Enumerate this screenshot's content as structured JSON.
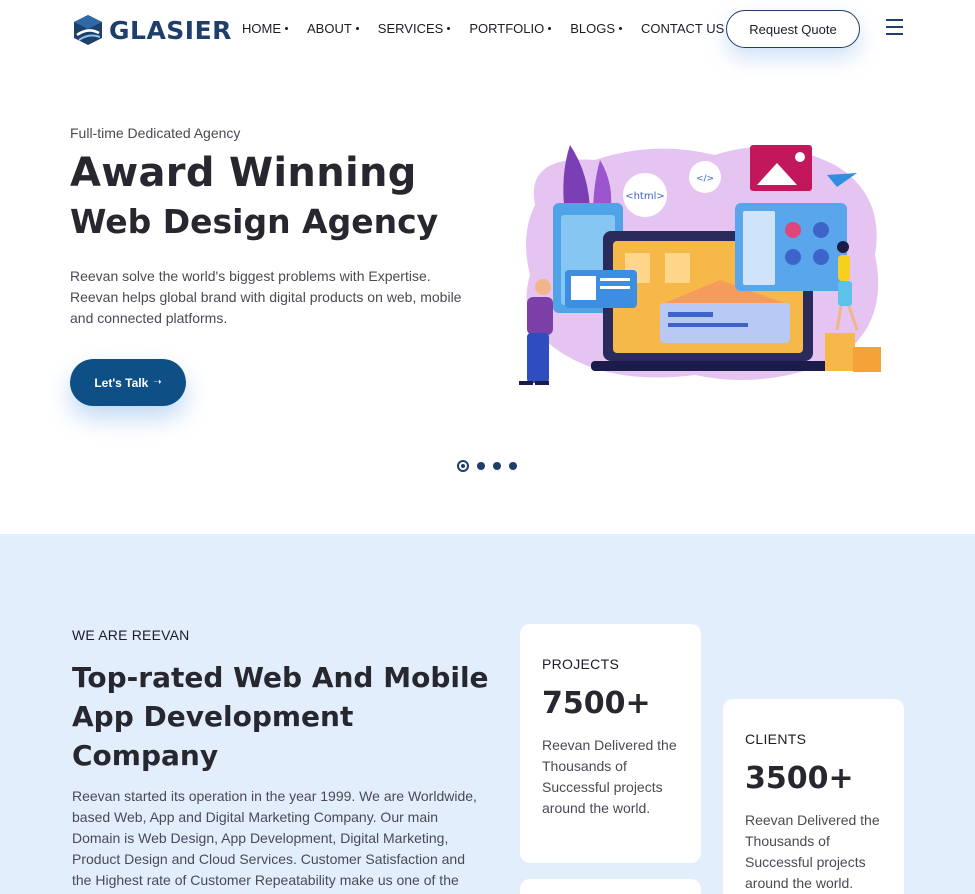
{
  "header": {
    "brand": "GLASIER",
    "nav": [
      "HOME",
      "ABOUT",
      "SERVICES",
      "PORTFOLIO",
      "BLOGS",
      "CONTACT US"
    ],
    "cta": "Request Quote"
  },
  "hero": {
    "subtitle": "Full-time Dedicated Agency",
    "title_line1": "Award Winning",
    "title_line2": "Web Design Agency",
    "description": "Reevan solve the world's biggest problems with Expertise. Reevan helps global brand with digital products on web, mobile and connected platforms.",
    "button": "Let's Talk",
    "button_arrow": "➝",
    "illustration_labels": {
      "html_tag": "<html>",
      "code_tag": "</>"
    },
    "slider_count": 4,
    "slider_active": 1
  },
  "about": {
    "eyebrow": "WE ARE REEVAN",
    "title_highlight": "Top-rated",
    "title_rest": " Web And Mobile App Development Company",
    "description": "Reevan started its operation in the year 1999. We are Worldwide, based Web, App and Digital Marketing Company. Our main Domain is Web Design, App Development, Digital Marketing, Product Design and Cloud Services. Customer Satisfaction and the Highest rate of Customer Repeatability make us one of the pioneers in the field. So,",
    "stats": [
      {
        "label": "PROJECTS",
        "value": "7500+",
        "text": "Reevan Delivered the Thousands of Successful projects around the world."
      },
      {
        "label": "CLIENTS",
        "value": "3500+",
        "text": "Reevan Delivered the Thousands of Successful projects around the world."
      }
    ]
  },
  "colors": {
    "primary": "#0e4f85",
    "brand": "#1e3f6b",
    "section_bg": "#e3eefd",
    "highlight": "#7fd3ea"
  }
}
